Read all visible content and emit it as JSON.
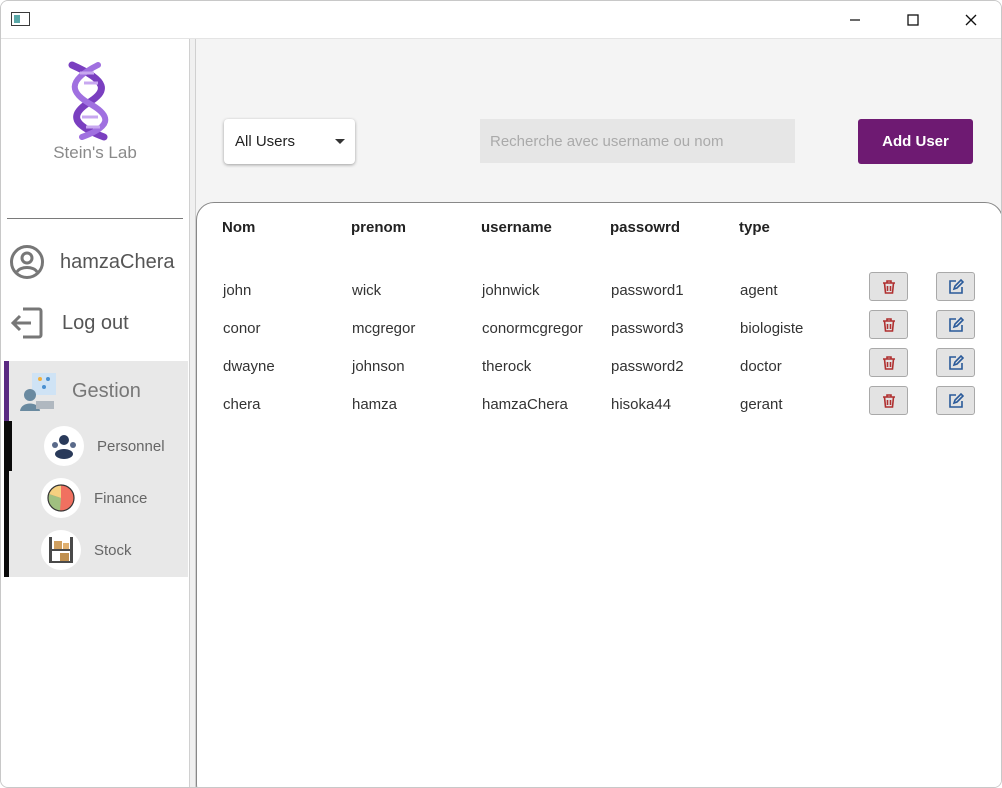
{
  "window": {
    "controls": {
      "minimize_icon": "minimize-icon",
      "maximize_icon": "maximize-icon",
      "close_icon": "close-icon"
    }
  },
  "sidebar": {
    "brand": "Stein's Lab",
    "user": {
      "name": "hamzaChera",
      "icon": "user-circle-icon"
    },
    "logout": {
      "label": "Log out",
      "icon": "logout-icon"
    },
    "gestion": {
      "label": "Gestion",
      "icon": "gestion-icon",
      "items": [
        {
          "label": "Personnel",
          "icon": "people-icon"
        },
        {
          "label": "Finance",
          "icon": "pie-chart-icon"
        },
        {
          "label": "Stock",
          "icon": "shelves-icon"
        }
      ]
    }
  },
  "toolbar": {
    "filter_value": "All Users",
    "search_placeholder": "Recherche avec username ou nom",
    "add_label": "Add User"
  },
  "table": {
    "headers": [
      "Nom",
      "prenom",
      "username",
      "passowrd",
      "type"
    ],
    "rows": [
      [
        "john",
        "wick",
        "johnwick",
        "password1",
        "agent"
      ],
      [
        "conor",
        "mcgregor",
        "conormcgregor",
        "password3",
        "biologiste"
      ],
      [
        "dwayne",
        "johnson",
        "therock",
        "password2",
        "doctor"
      ],
      [
        "chera",
        "hamza",
        "hamzaChera",
        "hisoka44",
        "gerant"
      ]
    ],
    "delete_icon": "trash-icon",
    "edit_icon": "edit-icon"
  },
  "colors": {
    "accent": "#6e1a72",
    "gestion_bar": "#5a2a82",
    "delete": "#b03030",
    "edit": "#2a5a9a"
  }
}
